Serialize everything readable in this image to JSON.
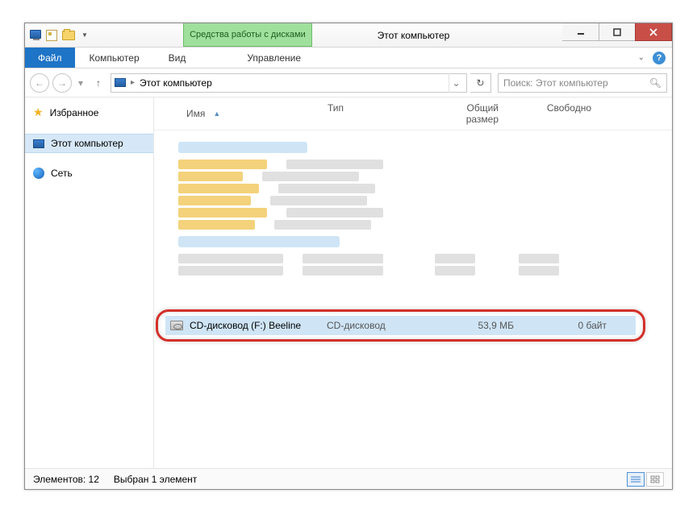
{
  "window": {
    "title": "Этот компьютер",
    "contextual_tab": "Средства работы с дисками"
  },
  "ribbon": {
    "file": "Файл",
    "computer": "Компьютер",
    "view": "Вид",
    "manage": "Управление"
  },
  "address": {
    "location": "Этот компьютер"
  },
  "search": {
    "placeholder": "Поиск: Этот компьютер"
  },
  "nav": {
    "favorites": "Избранное",
    "this_pc": "Этот компьютер",
    "network": "Сеть"
  },
  "columns": {
    "name": "Имя",
    "type": "Тип",
    "total": "Общий размер",
    "free": "Свободно"
  },
  "selected_item": {
    "name": "CD-дисковод (F:) Beeline",
    "type": "CD-дисковод",
    "size": "53,9 МБ",
    "free": "0 байт"
  },
  "status": {
    "items": "Элементов: 12",
    "selected": "Выбран 1 элемент"
  }
}
